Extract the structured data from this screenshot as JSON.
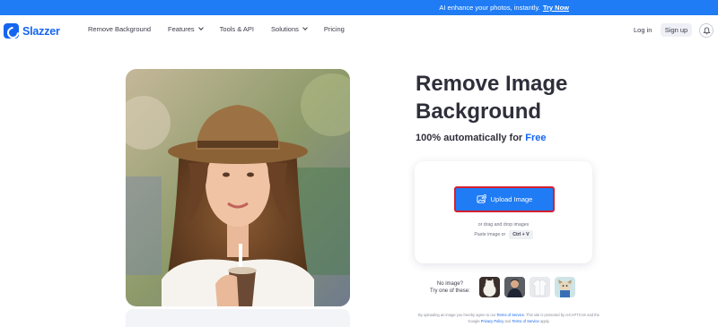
{
  "banner": {
    "text": "AI enhance your photos, instantly.",
    "cta": "Try Now"
  },
  "brand": {
    "name": "Slazzer",
    "color": "#1565f0"
  },
  "nav": {
    "items": [
      {
        "label": "Remove Background",
        "dropdown": false
      },
      {
        "label": "Features",
        "dropdown": true
      },
      {
        "label": "Tools & API",
        "dropdown": false
      },
      {
        "label": "Solutions",
        "dropdown": true
      },
      {
        "label": "Pricing",
        "dropdown": false
      }
    ],
    "login": "Log in",
    "signup": "Sign up",
    "bell_icon": "bell-icon"
  },
  "hero": {
    "title_line1": "Remove Image",
    "title_line2": "Background",
    "subtitle_prefix": "100% automatically for",
    "subtitle_highlight": "Free"
  },
  "upload": {
    "button_label": "Upload Image",
    "button_icon": "image-upload-icon",
    "drag_text": "or drag and drop images",
    "paste_text": "Paste image or",
    "shortcut": "Ctrl + V"
  },
  "samples": {
    "prompt_line1": "No image?",
    "prompt_line2": "Try one of these:",
    "items": [
      "sample-cat",
      "sample-man",
      "sample-shirt",
      "sample-dog"
    ]
  },
  "legal": {
    "part1": "By uploading an image you hereby agree to our",
    "terms_link": "Terms of Service",
    "part2": ". This site is protected by reCAPTCHA and the Google",
    "privacy_link": "Privacy Policy",
    "part3": "and",
    "google_terms_link": "Terms of Service",
    "part4": "apply."
  },
  "colors": {
    "accent": "#1f7cf4",
    "highlight_border": "#d61f2f"
  }
}
